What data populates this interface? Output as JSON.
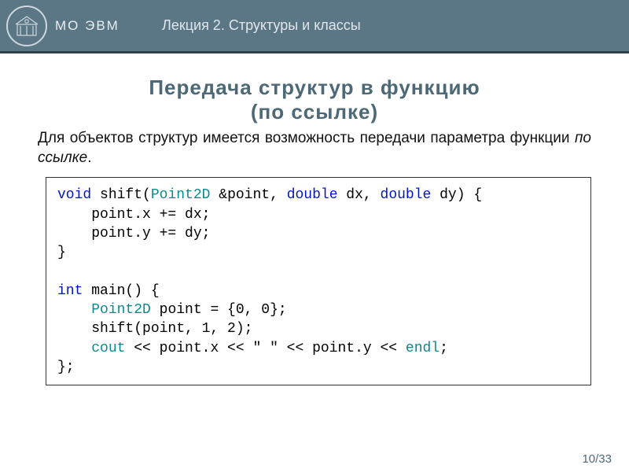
{
  "header": {
    "org": "МО ЭВМ",
    "lecture": "Лекция 2.  Структуры и классы"
  },
  "title": {
    "line1": "Передача структур в функцию",
    "line2": "(по ссылке)"
  },
  "paragraph": {
    "pre": "Для объектов структур имеется возможность передачи параметра функции ",
    "em": "по ссылке",
    "post": "."
  },
  "code": {
    "l1a": "void",
    "l1b": " shift(",
    "l1c": "Point2D",
    "l1d": " &point, ",
    "l1e": "double",
    "l1f": " dx, ",
    "l1g": "double",
    "l1h": " dy) {",
    "l2": "    point.x += dx;",
    "l3": "    point.y += dy;",
    "l4": "}",
    "l5": "",
    "l6a": "int",
    "l6b": " main() {",
    "l7a": "    ",
    "l7b": "Point2D",
    "l7c": " point = {0, 0};",
    "l8": "    shift(point, 1, 2);",
    "l9a": "    ",
    "l9b": "cout",
    "l9c": " << point.x << \" \" << point.y << ",
    "l9d": "endl",
    "l9e": ";",
    "l10": "};"
  },
  "page": {
    "num": "10/33"
  }
}
